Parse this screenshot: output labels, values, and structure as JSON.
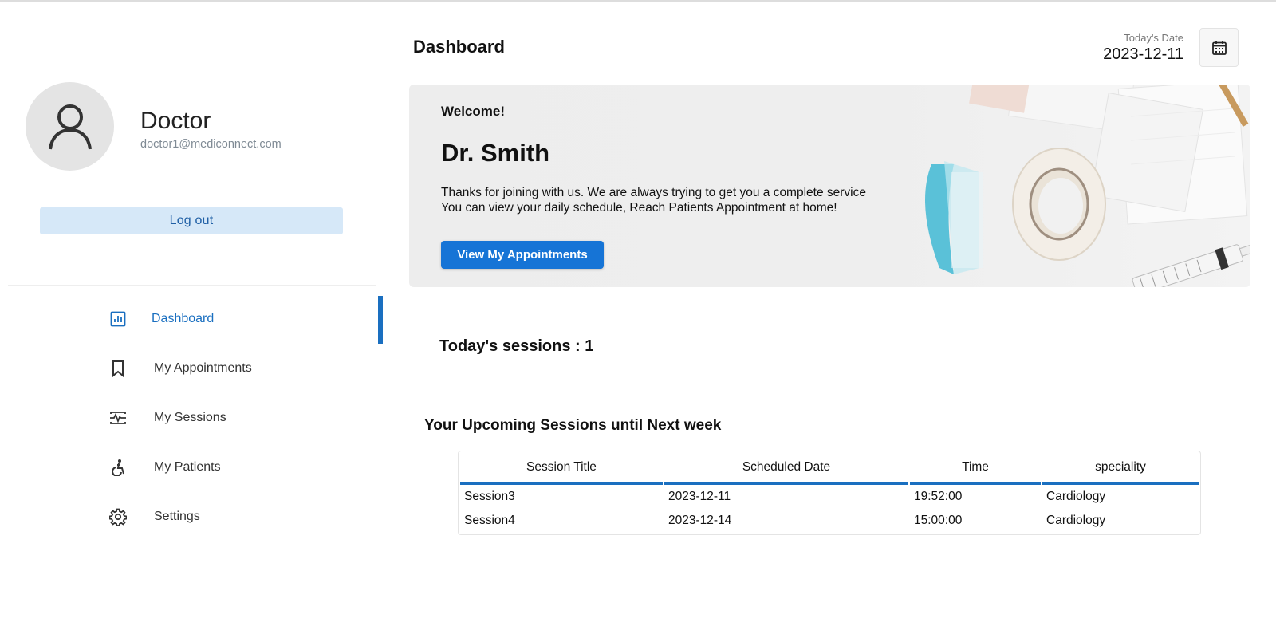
{
  "profile": {
    "name": "Doctor",
    "email": "doctor1@mediconnect.com",
    "logout_label": "Log out"
  },
  "nav": {
    "items": [
      {
        "label": "Dashboard",
        "icon": "dashboard-icon",
        "active": true
      },
      {
        "label": "My Appointments",
        "icon": "bookmark-icon",
        "active": false
      },
      {
        "label": "My Sessions",
        "icon": "sessions-icon",
        "active": false
      },
      {
        "label": "My Patients",
        "icon": "accessibility-icon",
        "active": false
      },
      {
        "label": "Settings",
        "icon": "gear-icon",
        "active": false
      }
    ]
  },
  "header": {
    "title": "Dashboard",
    "date_label": "Today's Date",
    "date_value": "2023-12-11",
    "calendar_icon": "calendar-icon"
  },
  "banner": {
    "welcome": "Welcome!",
    "doctor_name": "Dr. Smith",
    "line1": "Thanks for joining with us. We are always trying to get you a complete service",
    "line2": "You can view your daily schedule, Reach Patients Appointment at home!",
    "button_label": "View My Appointments"
  },
  "sessions_today": "Today's sessions : 1",
  "upcoming": {
    "title": "Your Upcoming Sessions until Next week",
    "columns": [
      "Session Title",
      "Scheduled Date",
      "Time",
      "speciality"
    ],
    "rows": [
      [
        "Session3",
        "2023-12-11",
        "19:52:00",
        "Cardiology"
      ],
      [
        "Session4",
        "2023-12-14",
        "15:00:00",
        "Cardiology"
      ]
    ]
  },
  "colors": {
    "accent": "#1a6fc0",
    "button": "#1674d6",
    "logout_bg": "#d6e8f8"
  }
}
